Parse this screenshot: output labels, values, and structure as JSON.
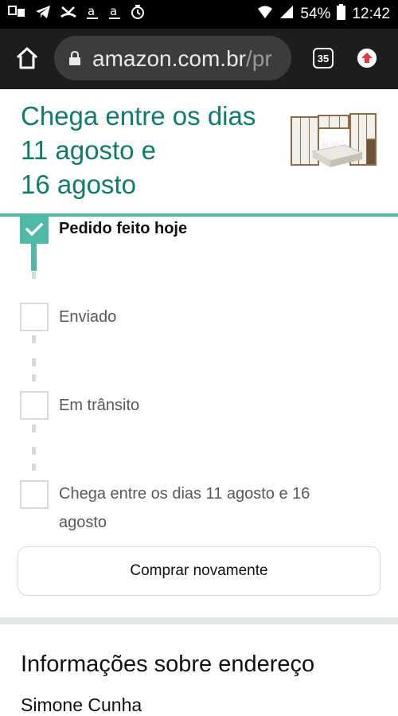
{
  "status_bar": {
    "battery": "54%",
    "time": "12:42"
  },
  "browser": {
    "url_domain": "amazon.com.br",
    "url_path": "/pr",
    "tab_count": "35"
  },
  "delivery": {
    "headline_line1": "Chega entre os dias",
    "headline_line2": "11 agosto e",
    "headline_line3": "16 agosto"
  },
  "steps": [
    {
      "label": "Pedido feito hoje",
      "done": true
    },
    {
      "label": "Enviado",
      "done": false
    },
    {
      "label": "Em trânsito",
      "done": false
    },
    {
      "label": "Chega entre os dias 11 agosto e 16 agosto",
      "done": false
    }
  ],
  "actions": {
    "buy_again": "Comprar novamente"
  },
  "address": {
    "title": "Informações sobre endereço",
    "name": "Simone Cunha"
  },
  "colors": {
    "accent_teal": "#4fb9a6",
    "headline_green": "#0f7c6b"
  }
}
